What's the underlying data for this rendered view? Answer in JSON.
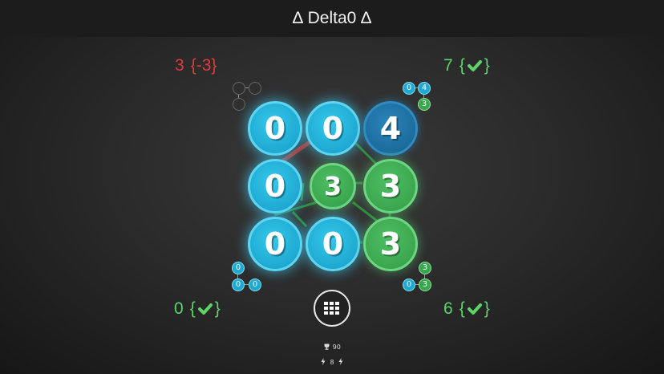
{
  "header": {
    "title": "∆ Delta0 ∆"
  },
  "corners": {
    "top_left": {
      "value": "3",
      "delta": "{-3}",
      "status": "wrong",
      "color": "#e03a3a"
    },
    "top_right": {
      "value": "7",
      "open": "{",
      "close": "}",
      "status": "check",
      "color": "#5ed468"
    },
    "bottom_left": {
      "value": "0",
      "open": "{",
      "close": "}",
      "status": "check",
      "color": "#5ed468"
    },
    "bottom_right": {
      "value": "6",
      "open": "{",
      "close": "}",
      "status": "check",
      "color": "#5ed468"
    }
  },
  "board": {
    "rows": [
      [
        {
          "value": "0",
          "state": "cyan"
        },
        {
          "value": "0",
          "state": "cyan"
        },
        {
          "value": "4",
          "state": "blue"
        }
      ],
      [
        {
          "value": "0",
          "state": "cyan"
        },
        {
          "value": "3",
          "state": "green-small"
        },
        {
          "value": "3",
          "state": "green"
        }
      ],
      [
        {
          "value": "0",
          "state": "cyan"
        },
        {
          "value": "0",
          "state": "cyan"
        },
        {
          "value": "3",
          "state": "green"
        }
      ]
    ]
  },
  "mini_indicators": {
    "top_left": {
      "a": "",
      "b": "",
      "c": ""
    },
    "top_right": {
      "a": "0",
      "b": "4",
      "c": "3"
    },
    "bottom_left": {
      "a": "0",
      "b": "0",
      "c": "0"
    },
    "bottom_right": {
      "a": "3",
      "b": "0",
      "c": "3"
    }
  },
  "menu_button": {
    "icon": "grid-icon"
  },
  "stats": {
    "trophy_icon": "trophy-icon",
    "score": "90",
    "bolt_icon": "bolt-icon",
    "moves": "8"
  },
  "colors": {
    "cyan": "#1fa9d2",
    "green": "#3aa74f",
    "blue": "#1c6b9c",
    "red": "#e03a3a",
    "check_green": "#5ed468"
  }
}
